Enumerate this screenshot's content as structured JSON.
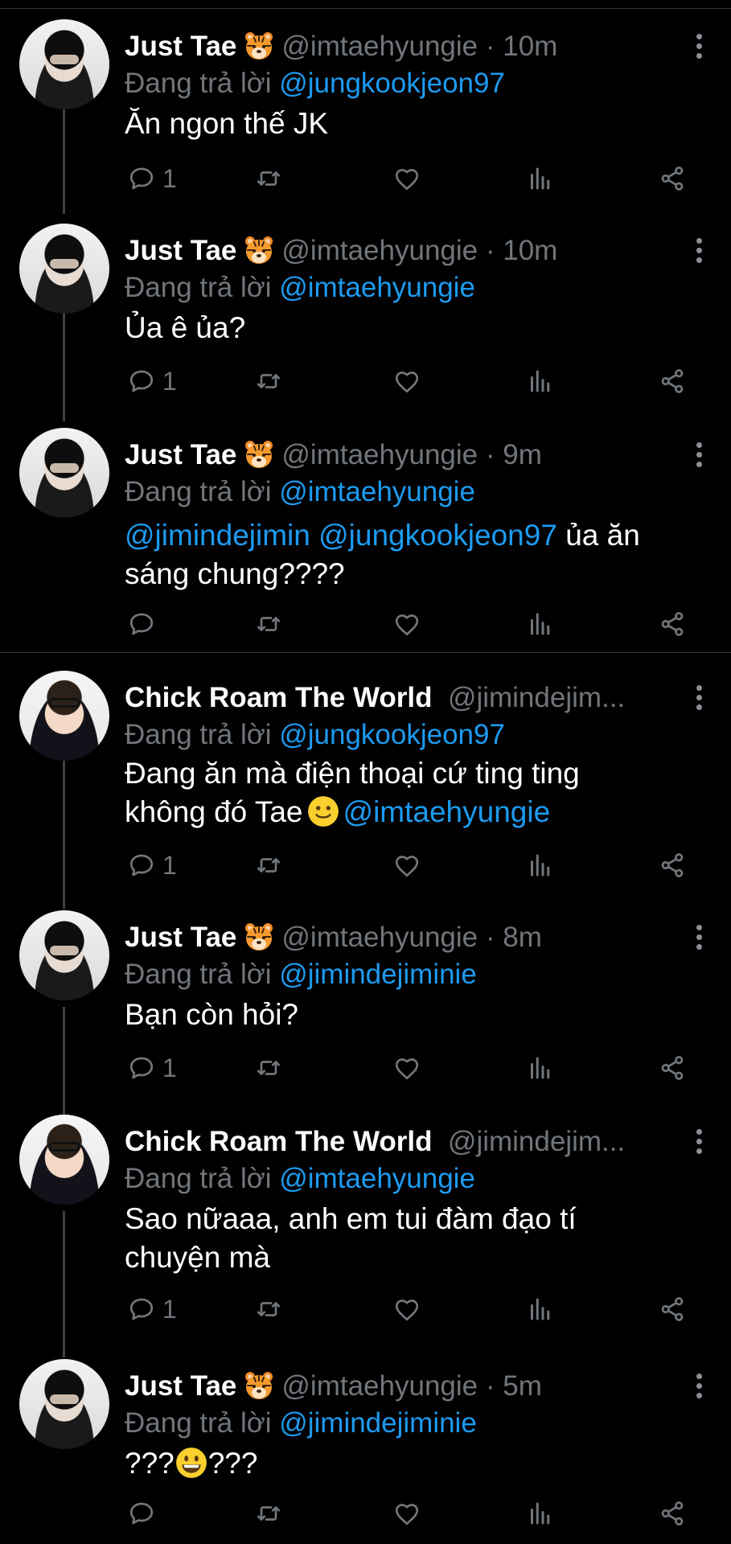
{
  "colors": {
    "background": "#000000",
    "text": "#ffffff",
    "muted": "#71767b",
    "link": "#1d9bf0",
    "divider": "#2f3336"
  },
  "icons": {
    "reply": "speech-bubble-icon",
    "retweet": "retweet-icon",
    "like": "heart-icon",
    "views": "bar-chart-icon",
    "share": "share-icon",
    "more": "vertical-dots-icon",
    "badge": "tiger-emoji"
  },
  "reply_label": "Đang trả lời",
  "tweets": [
    {
      "user": "Just Tae",
      "handle": "@imtaehyungie",
      "time": "· 10m",
      "reply_to": "@jungkookjeon97",
      "text": "Ăn ngon thế JK",
      "reply_count": "1"
    },
    {
      "user": "Just Tae",
      "handle": "@imtaehyungie",
      "time": "· 10m",
      "reply_to": "@imtaehyungie",
      "text": "Ủa ê ủa?",
      "reply_count": "1"
    },
    {
      "user": "Just Tae",
      "handle": "@imtaehyungie",
      "time": "· 9m",
      "reply_to": "@imtaehyungie",
      "mention1": "@jimindejimin",
      "mention2": "@jungkookjeon97",
      "text_tail": "ủa ăn",
      "text_line2": "sáng chung????",
      "reply_count": ""
    },
    {
      "user": "Chick Roam The World",
      "handle": "@jimindejim...",
      "time": "",
      "reply_to": "@jungkookjeon97",
      "text_line1": "Đang ăn mà điện thoại cứ ting ting",
      "text_line2": "không đó Tae",
      "mention": "@imtaehyungie",
      "reply_count": "1"
    },
    {
      "user": "Just Tae",
      "handle": "@imtaehyungie",
      "time": "· 8m",
      "reply_to": "@jimindejiminie",
      "text": "Bạn còn hỏi?",
      "reply_count": "1"
    },
    {
      "user": "Chick Roam The World",
      "handle": "@jimindejim...",
      "time": "",
      "reply_to": "@imtaehyungie",
      "text_line1": "Sao nữaaa, anh em tui đàm đạo tí",
      "text_line2": "chuyện mà",
      "reply_count": "1"
    },
    {
      "user": "Just Tae",
      "handle": "@imtaehyungie",
      "time": "· 5m",
      "reply_to": "@jimindejiminie",
      "text_pre": "???",
      "text_post": "???",
      "reply_count": ""
    }
  ]
}
